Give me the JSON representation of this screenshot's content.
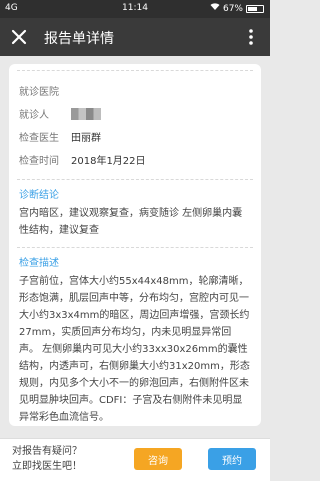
{
  "status_bar": {
    "network": "4G",
    "time": "11:14",
    "battery": "67%",
    "battery_level": 0.67
  },
  "app_bar": {
    "title": "报告单详情"
  },
  "info": {
    "hospital_label": "就诊医院",
    "hospital_value": "",
    "patient_label": "就诊人",
    "doctor_label": "检查医生",
    "doctor_value": "田丽群",
    "time_label": "检查时间",
    "time_value": "2018年1月22日"
  },
  "diagnosis": {
    "title": "诊断结论",
    "text": "宫内暗区，建议观察复查，病变随诊 左侧卵巢内囊性结构，建议复查"
  },
  "description": {
    "title": "检查描述",
    "text": "子宫前位，宫体大小约55x44x48mm，轮廓清晰，形态饱满，肌层回声中等，分布均匀，宫腔内可见一大小约3x3x4mm的暗区，周边回声增强，宫颈长约27mm，实质回声分布均匀，内未见明显异常回声。 左侧卵巢内可见大小约33xx30x26mm的囊性结构，内透声可，右侧卵巢大小约31x20mm，形态规则，内见多个大小不一的卵泡回声，右侧附件区未见明显肿块回声。CDFI：子宫及右侧附件未见明显异常彩色血流信号。"
  },
  "bottom": {
    "question_line1": "对报告有疑问？",
    "question_line2": "立即找医生吧！",
    "consult_label": "咨询",
    "book_label": "预约"
  }
}
